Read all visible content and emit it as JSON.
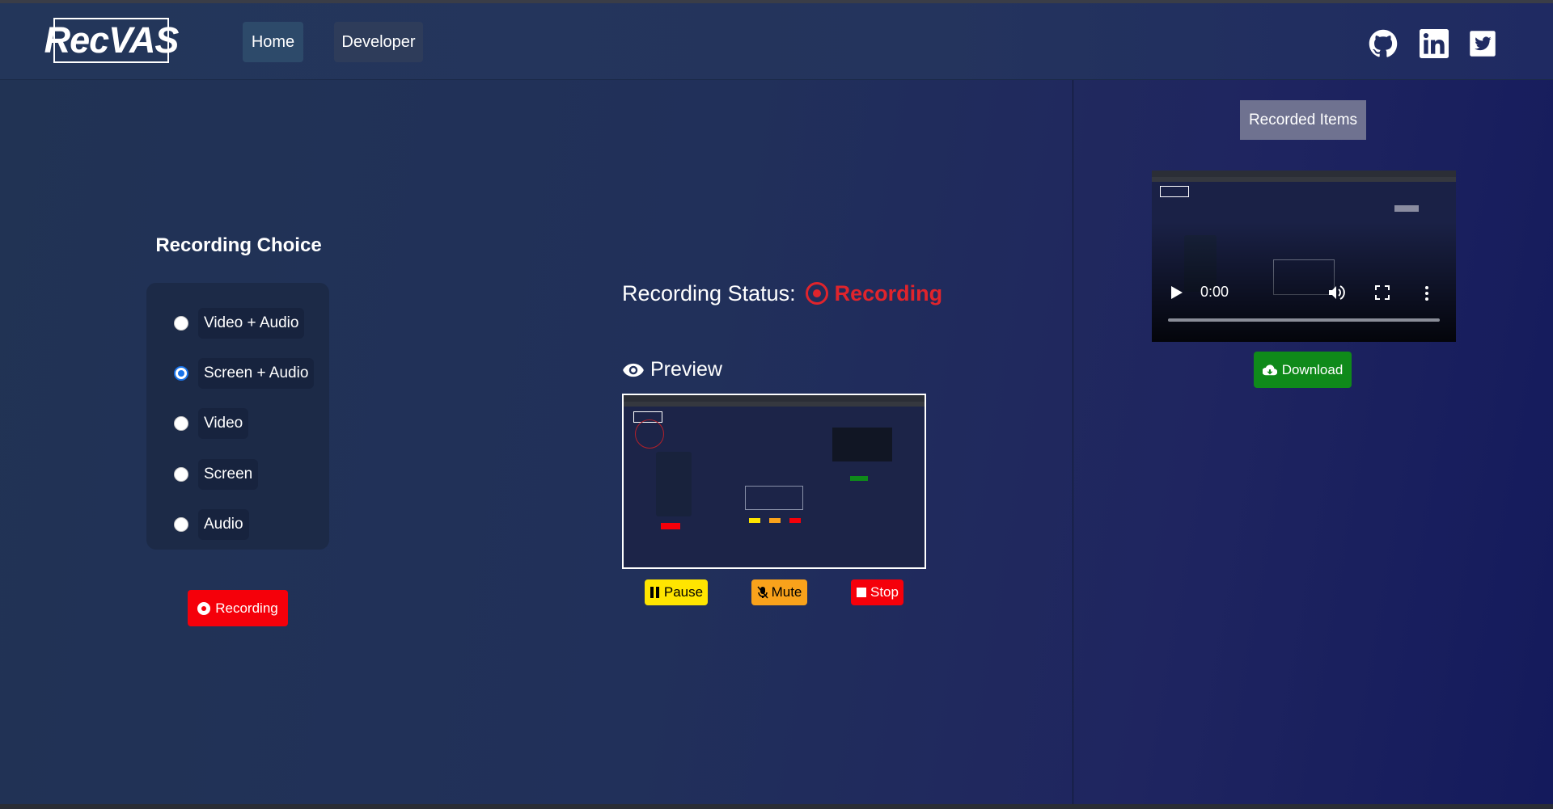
{
  "nav": {
    "logo": "RecVAS",
    "home_label": "Home",
    "developer_label": "Developer",
    "social": [
      "github-icon",
      "linkedin-icon",
      "twitter-icon"
    ]
  },
  "choice": {
    "title": "Recording Choice",
    "options": [
      {
        "label": "Video + Audio",
        "checked": false
      },
      {
        "label": "Screen + Audio",
        "checked": true
      },
      {
        "label": "Video",
        "checked": false
      },
      {
        "label": "Screen",
        "checked": false
      },
      {
        "label": "Audio",
        "checked": false
      }
    ],
    "record_button": "Recording"
  },
  "status": {
    "label": "Recording Status:",
    "value": "Recording",
    "color": "#e0242c"
  },
  "preview": {
    "title": "Preview",
    "pause_label": "Pause",
    "mute_label": "Mute",
    "stop_label": "Stop"
  },
  "recorded": {
    "title": "Recorded Items",
    "video_time": "0:00",
    "download_label": "Download"
  },
  "colors": {
    "accent_blue": "#1a73e8",
    "record_red": "#f5000a",
    "pause_yellow": "#ffe500",
    "mute_orange": "#f9a21b",
    "download_green": "#0f8a1a"
  }
}
